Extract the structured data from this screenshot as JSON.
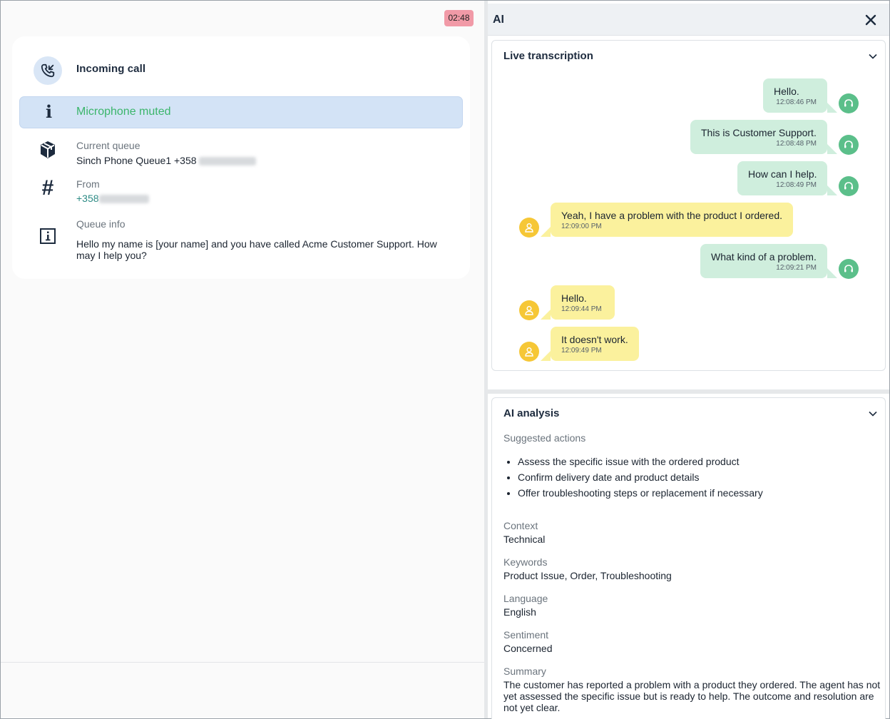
{
  "call": {
    "timer": "02:48",
    "title": "Incoming call",
    "mute_status": "Microphone muted",
    "current_queue_label": "Current queue",
    "current_queue_value": "Sinch Phone Queue1 +358",
    "from_label": "From",
    "from_value": "+358",
    "queue_info_label": "Queue info",
    "queue_info_text": "Hello my name is [your name] and you have called Acme Customer Support. How may I help you?"
  },
  "ai_panel": {
    "title": "AI",
    "close_icon": "close-icon"
  },
  "transcription": {
    "title": "Live transcription",
    "messages": [
      {
        "speaker": "agent",
        "text": "Hello.",
        "time": "12:08:46 PM"
      },
      {
        "speaker": "agent",
        "text": "This is Customer Support.",
        "time": "12:08:48 PM"
      },
      {
        "speaker": "agent",
        "text": "How can I help.",
        "time": "12:08:49 PM"
      },
      {
        "speaker": "customer",
        "text": "Yeah, I have a problem with the product I ordered.",
        "time": "12:09:00 PM"
      },
      {
        "speaker": "agent",
        "text": "What kind of a problem.",
        "time": "12:09:21 PM"
      },
      {
        "speaker": "customer",
        "text": "Hello.",
        "time": "12:09:44 PM"
      },
      {
        "speaker": "customer",
        "text": "It doesn't work.",
        "time": "12:09:49 PM"
      }
    ]
  },
  "analysis": {
    "title": "AI analysis",
    "suggested_label": "Suggested actions",
    "actions": [
      "Assess the specific issue with the ordered product",
      "Confirm delivery date and product details",
      "Offer troubleshooting steps or replacement if necessary"
    ],
    "context_label": "Context",
    "context_value": "Technical",
    "keywords_label": "Keywords",
    "keywords_value": "Product Issue, Order, Troubleshooting",
    "language_label": "Language",
    "language_value": "English",
    "sentiment_label": "Sentiment",
    "sentiment_value": "Concerned",
    "summary_label": "Summary",
    "summary_value": "The customer has reported a problem with a product they ordered. The agent has not yet assessed the specific issue but is ready to help. The outcome and resolution are not yet clear."
  },
  "colors": {
    "agent_bubble": "#cfeedd",
    "customer_bubble": "#fbf19d",
    "mute_text": "#3bb56b",
    "timer_bg": "#f19aa7"
  }
}
